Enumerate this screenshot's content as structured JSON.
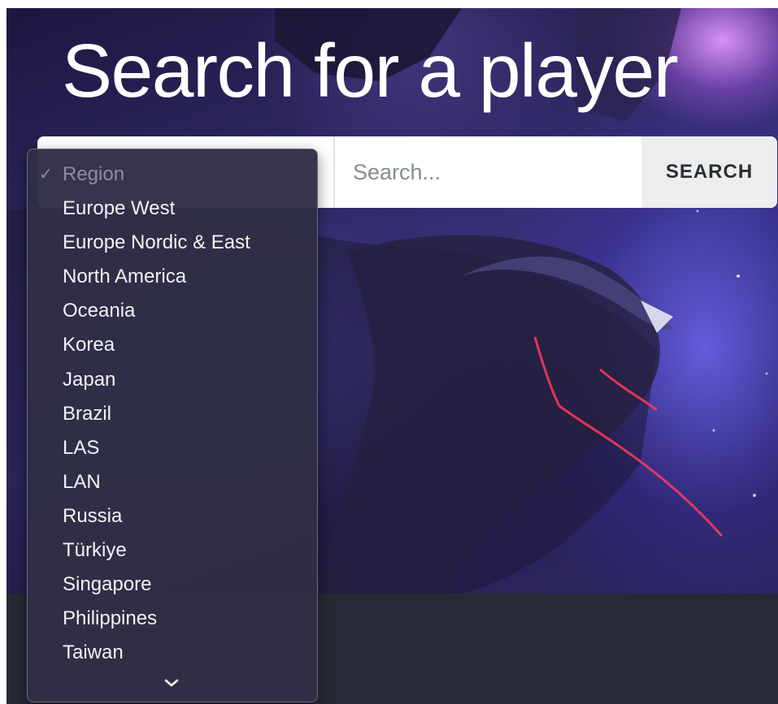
{
  "page": {
    "title": "Search for a player"
  },
  "search": {
    "placeholder": "Search...",
    "value": "",
    "button_label": "SEARCH"
  },
  "region_dropdown": {
    "selected": "Region",
    "check_glyph": "✓",
    "options": [
      "Region",
      "Europe West",
      "Europe Nordic & East",
      "North America",
      "Oceania",
      "Korea",
      "Japan",
      "Brazil",
      "LAS",
      "LAN",
      "Russia",
      "Türkiye",
      "Singapore",
      "Philippines",
      "Taiwan"
    ],
    "scroll_indicator_icon": "chevron-down-icon"
  },
  "colors": {
    "hero_base": "#2d2760",
    "hero_accent": "#e096ff",
    "footer_band": "#272a35",
    "dropdown_bg": "#302e46",
    "search_button_bg": "#ededee",
    "glow_red": "#ff3b5c"
  }
}
